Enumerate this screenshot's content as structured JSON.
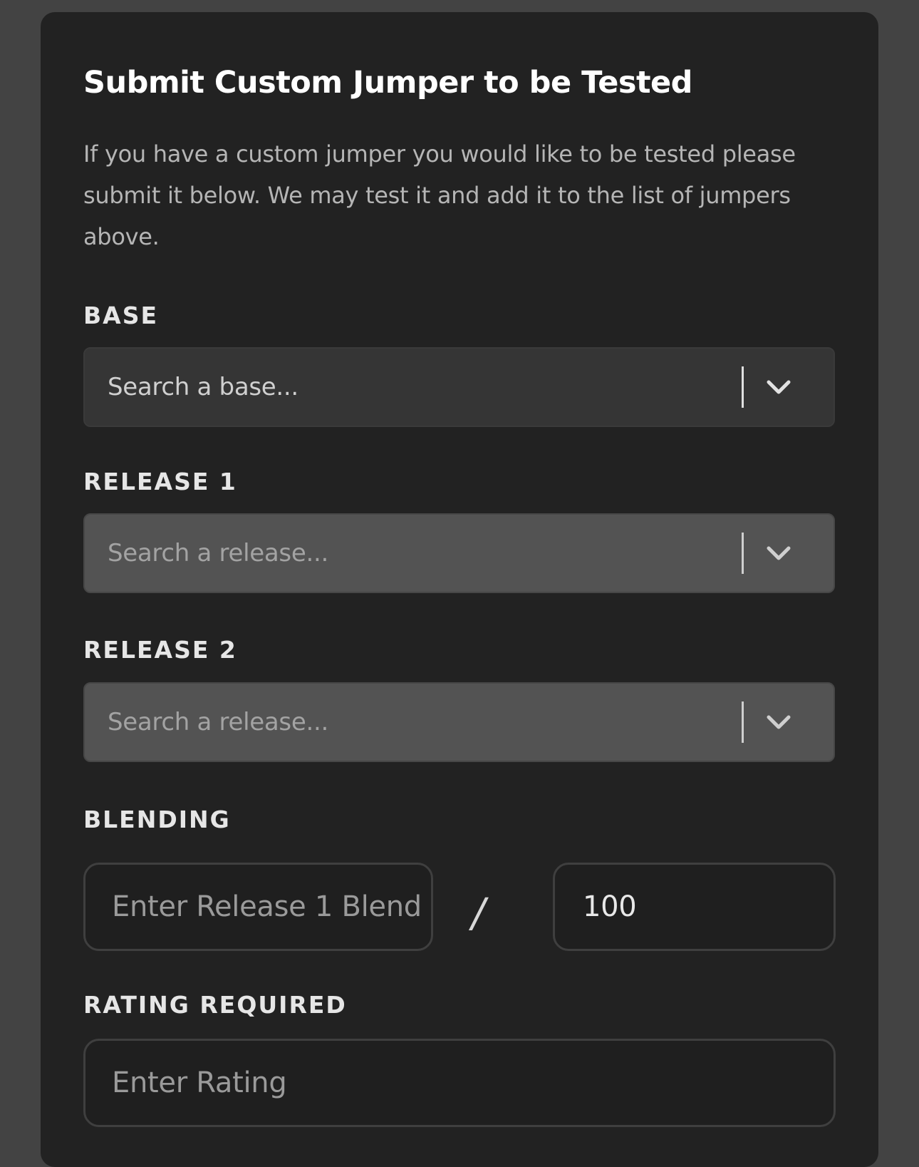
{
  "form": {
    "title": "Submit Custom Jumper to be Tested",
    "description": "If you have a custom jumper you would like to be tested please submit it below. We may test it and add it to the list of jumpers above.",
    "base": {
      "label": "BASE",
      "placeholder": "Search a base...",
      "icon": "chevron-down-icon"
    },
    "release1": {
      "label": "RELEASE 1",
      "placeholder": "Search a release...",
      "icon": "chevron-down-icon"
    },
    "release2": {
      "label": "RELEASE 2",
      "placeholder": "Search a release...",
      "icon": "chevron-down-icon"
    },
    "blending": {
      "label": "BLENDING",
      "release1_placeholder": "Enter Release 1 Blend",
      "separator": "/",
      "total_value": "100"
    },
    "rating": {
      "label": "RATING REQUIRED",
      "placeholder": "Enter Rating"
    }
  },
  "colors": {
    "page_background": "#434343",
    "card_background": "#222222",
    "select_background": "#353535",
    "select_disabled_background": "#535353",
    "input_background": "#1f1f1f",
    "title_text": "#ffffff"
  }
}
